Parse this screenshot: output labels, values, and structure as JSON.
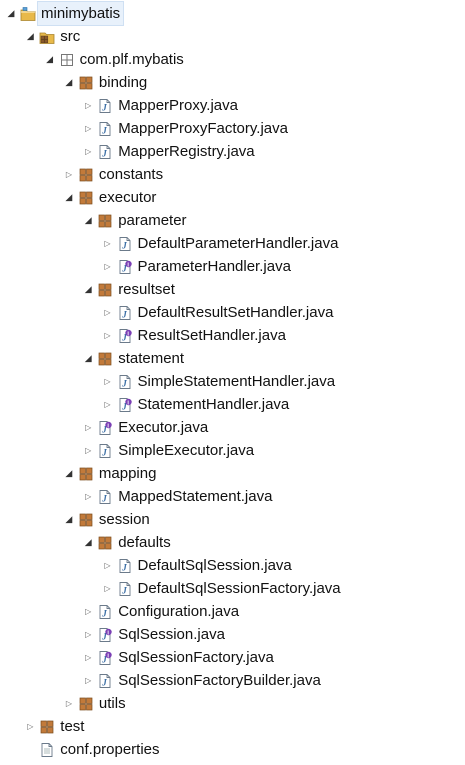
{
  "tree": [
    {
      "label": "minimybatis",
      "type": "project",
      "twisty": "expanded",
      "selected": true,
      "depth": 0
    },
    {
      "label": "src",
      "type": "srcfolder",
      "twisty": "expanded",
      "depth": 1
    },
    {
      "label": "com.plf.mybatis",
      "type": "package-empty",
      "twisty": "expanded",
      "depth": 2
    },
    {
      "label": "binding",
      "type": "package",
      "twisty": "expanded",
      "depth": 3
    },
    {
      "label": "MapperProxy.java",
      "type": "class",
      "twisty": "collapsed",
      "depth": 4
    },
    {
      "label": "MapperProxyFactory.java",
      "type": "class",
      "twisty": "collapsed",
      "depth": 4
    },
    {
      "label": "MapperRegistry.java",
      "type": "class",
      "twisty": "collapsed",
      "depth": 4
    },
    {
      "label": "constants",
      "type": "package",
      "twisty": "collapsed",
      "depth": 3
    },
    {
      "label": "executor",
      "type": "package",
      "twisty": "expanded",
      "depth": 3
    },
    {
      "label": "parameter",
      "type": "package",
      "twisty": "expanded",
      "depth": 4
    },
    {
      "label": "DefaultParameterHandler.java",
      "type": "class",
      "twisty": "collapsed",
      "depth": 5
    },
    {
      "label": "ParameterHandler.java",
      "type": "interface",
      "twisty": "collapsed",
      "depth": 5
    },
    {
      "label": "resultset",
      "type": "package",
      "twisty": "expanded",
      "depth": 4
    },
    {
      "label": "DefaultResultSetHandler.java",
      "type": "class",
      "twisty": "collapsed",
      "depth": 5
    },
    {
      "label": "ResultSetHandler.java",
      "type": "interface",
      "twisty": "collapsed",
      "depth": 5
    },
    {
      "label": "statement",
      "type": "package",
      "twisty": "expanded",
      "depth": 4
    },
    {
      "label": "SimpleStatementHandler.java",
      "type": "class",
      "twisty": "collapsed",
      "depth": 5
    },
    {
      "label": "StatementHandler.java",
      "type": "interface",
      "twisty": "collapsed",
      "depth": 5
    },
    {
      "label": "Executor.java",
      "type": "interface",
      "twisty": "collapsed",
      "depth": 4
    },
    {
      "label": "SimpleExecutor.java",
      "type": "class",
      "twisty": "collapsed",
      "depth": 4
    },
    {
      "label": "mapping",
      "type": "package",
      "twisty": "expanded",
      "depth": 3
    },
    {
      "label": "MappedStatement.java",
      "type": "class",
      "twisty": "collapsed",
      "depth": 4
    },
    {
      "label": "session",
      "type": "package",
      "twisty": "expanded",
      "depth": 3
    },
    {
      "label": "defaults",
      "type": "package",
      "twisty": "expanded",
      "depth": 4
    },
    {
      "label": "DefaultSqlSession.java",
      "type": "class",
      "twisty": "collapsed",
      "depth": 5
    },
    {
      "label": "DefaultSqlSessionFactory.java",
      "type": "class",
      "twisty": "collapsed",
      "depth": 5
    },
    {
      "label": "Configuration.java",
      "type": "class",
      "twisty": "collapsed",
      "depth": 4
    },
    {
      "label": "SqlSession.java",
      "type": "interface",
      "twisty": "collapsed",
      "depth": 4
    },
    {
      "label": "SqlSessionFactory.java",
      "type": "interface",
      "twisty": "collapsed",
      "depth": 4
    },
    {
      "label": "SqlSessionFactoryBuilder.java",
      "type": "class",
      "twisty": "collapsed",
      "depth": 4
    },
    {
      "label": "utils",
      "type": "package",
      "twisty": "collapsed",
      "depth": 3
    },
    {
      "label": "test",
      "type": "package",
      "twisty": "collapsed",
      "depth": 1
    },
    {
      "label": "conf.properties",
      "type": "file",
      "twisty": "none",
      "depth": 1
    }
  ],
  "colors": {
    "package": "#b5651d",
    "class_stroke": "#3a6ea5",
    "interface_badge": "#7b3fb5",
    "folder": "#e8b94a",
    "selection": "#e8f1fb"
  }
}
